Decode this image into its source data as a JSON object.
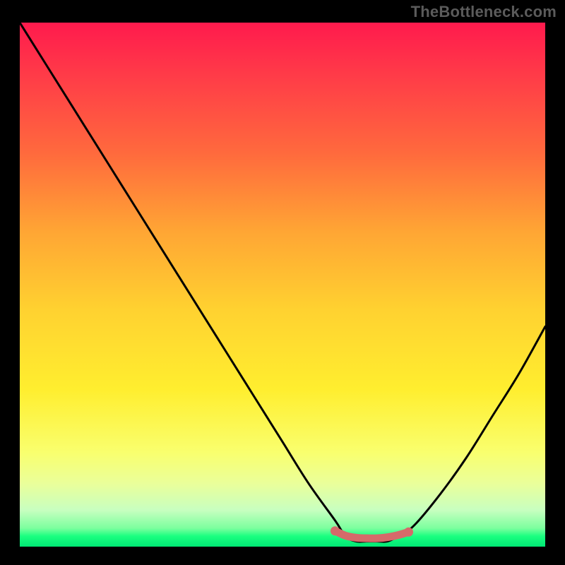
{
  "watermark": "TheBottleneck.com",
  "chart_data": {
    "type": "line",
    "title": "",
    "xlabel": "",
    "ylabel": "",
    "xlim": [
      0,
      100
    ],
    "ylim": [
      0,
      100
    ],
    "series": [
      {
        "name": "bottleneck-curve",
        "x": [
          0,
          5,
          10,
          15,
          20,
          25,
          30,
          35,
          40,
          45,
          50,
          55,
          60,
          62,
          64,
          66,
          68,
          70,
          72,
          75,
          80,
          85,
          90,
          95,
          100
        ],
        "values": [
          100,
          92,
          84,
          76,
          68,
          60,
          52,
          44,
          36,
          28,
          20,
          12,
          5,
          2,
          1,
          1,
          1,
          1,
          2,
          4,
          10,
          17,
          25,
          33,
          42
        ]
      },
      {
        "name": "optimal-marker",
        "x": [
          60,
          62,
          64,
          66,
          68,
          70,
          72,
          74
        ],
        "values": [
          3.0,
          2.1,
          1.7,
          1.6,
          1.6,
          1.8,
          2.2,
          2.8
        ]
      }
    ],
    "optimal_range": [
      60,
      74
    ]
  },
  "colors": {
    "curve": "#000000",
    "marker": "#d66a6a",
    "gradient_top": "#ff1a4d",
    "gradient_bottom": "#00e874",
    "background": "#000000"
  }
}
